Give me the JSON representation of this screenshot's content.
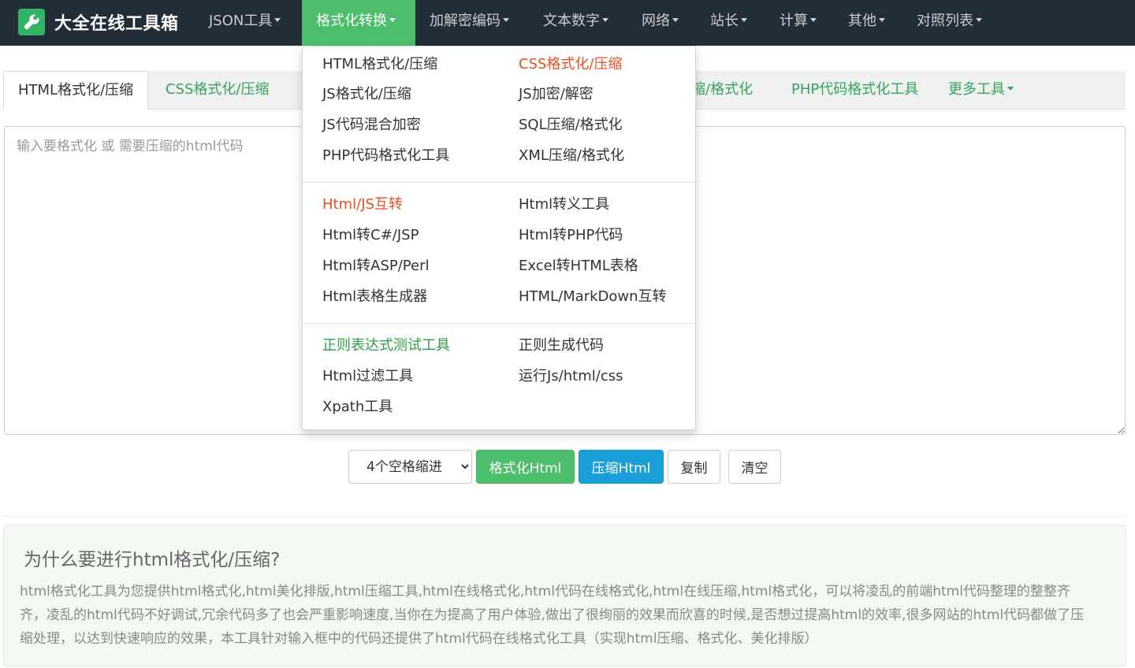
{
  "brand": {
    "name": "大全在线工具箱",
    "icon": "wrench-icon"
  },
  "nav": {
    "items": [
      {
        "label": "JSON工具"
      },
      {
        "label": "格式化转换"
      },
      {
        "label": "加解密编码"
      },
      {
        "label": "文本数字"
      },
      {
        "label": "网络"
      },
      {
        "label": "站长"
      },
      {
        "label": "计算"
      },
      {
        "label": "其他"
      },
      {
        "label": "对照列表"
      }
    ],
    "active_index": 1,
    "colors": {
      "bg": "#222d38",
      "active": "#4cbe6c"
    }
  },
  "tabs": [
    {
      "label": "HTML格式化/压缩"
    },
    {
      "label": "CSS格式化/压缩"
    },
    {
      "label": "缩/格式化"
    },
    {
      "label": "PHP代码格式化工具"
    },
    {
      "label": "更多工具"
    }
  ],
  "editor": {
    "placeholder": "输入要格式化 或 需要压缩的html代码"
  },
  "controls": {
    "indent_options": [
      "4个空格缩进"
    ],
    "format_label": "格式化Html",
    "compress_label": "压缩Html",
    "copy_label": "复制",
    "clear_label": "清空"
  },
  "info": {
    "title": "为什么要进行html格式化/压缩?",
    "body": "html格式化工具为您提供html格式化,html美化排版,html压缩工具,html在线格式化,html代码在线格式化,html在线压缩,html格式化，可以将凌乱的前端html代码整理的整整齐齐，凌乱的html代码不好调试,冗余代码多了也会严重影响速度,当你在为提高了用户体验,做出了很绚丽的效果而欣喜的时候,是否想过提高html的效率,很多网站的html代码都做了压缩处理，以达到快速响应的效果，本工具针对输入框中的代码还提供了html代码在线格式化工具（实现html压缩、格式化、美化排版）"
  },
  "dropdown": {
    "groups": [
      {
        "items": [
          {
            "label": "HTML格式化/压缩"
          },
          {
            "label": "CSS格式化/压缩",
            "color": "red"
          },
          {
            "label": "JS格式化/压缩"
          },
          {
            "label": "JS加密/解密"
          },
          {
            "label": "JS代码混合加密"
          },
          {
            "label": "SQL压缩/格式化"
          },
          {
            "label": "PHP代码格式化工具"
          },
          {
            "label": "XML压缩/格式化"
          }
        ]
      },
      {
        "items": [
          {
            "label": "Html/JS互转",
            "color": "red"
          },
          {
            "label": "Html转义工具"
          },
          {
            "label": "Html转C#/JSP"
          },
          {
            "label": "Html转PHP代码"
          },
          {
            "label": "Html转ASP/Perl"
          },
          {
            "label": "Excel转HTML表格"
          },
          {
            "label": "Html表格生成器"
          },
          {
            "label": "HTML/MarkDown互转"
          }
        ]
      },
      {
        "items": [
          {
            "label": "正则表达式测试工具",
            "color": "green"
          },
          {
            "label": "正则生成代码"
          },
          {
            "label": "Html过滤工具"
          },
          {
            "label": "运行Js/html/css"
          },
          {
            "label": "Xpath工具"
          }
        ]
      }
    ],
    "colors": {
      "red": "#e8501f",
      "green": "#2f9e46"
    }
  }
}
